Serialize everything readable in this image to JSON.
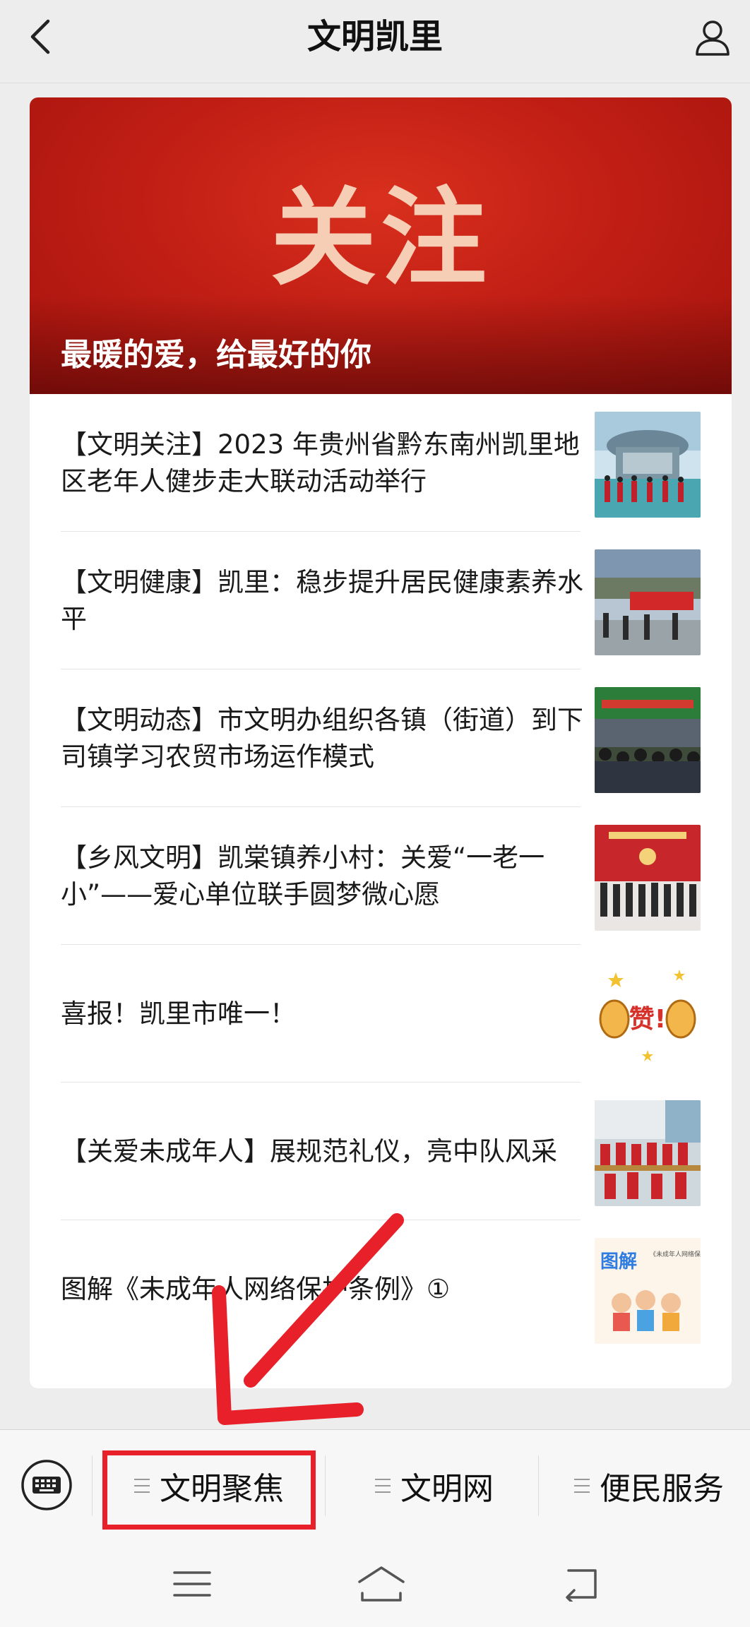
{
  "header": {
    "title": "文明凯里",
    "back_icon": "chevron-left-icon",
    "profile_icon": "user-icon"
  },
  "banner": {
    "big_text": "关注",
    "caption": "最暖的爱，给最好的你",
    "color": "#c21f15"
  },
  "articles": [
    {
      "title": "【文明关注】2023 年贵州省黔东南州凯里地区老年人健步走大联动活动举行"
    },
    {
      "title": "【文明健康】凯里：稳步提升居民健康素养水平"
    },
    {
      "title": "【文明动态】市文明办组织各镇（街道）到下司镇学习农贸市场运作模式"
    },
    {
      "title": "【乡风文明】凯棠镇养小村：关爱“一老一小”——爱心单位联手圆梦微心愿"
    },
    {
      "title": "喜报！凯里市唯一！"
    },
    {
      "title": "【关爱未成年人】展规范礼仪，亮中队风采"
    },
    {
      "title": "图解《未成年人网络保护条例》①"
    }
  ],
  "thumbs": {
    "thumb_5_label": "赞!",
    "thumb_7_title": "图解",
    "thumb_7_sub": "《未成年人网络保护条例》"
  },
  "menu": {
    "keyboard_icon": "keyboard-icon",
    "items": [
      {
        "label": "文明聚焦"
      },
      {
        "label": "文明网"
      },
      {
        "label": "便民服务"
      }
    ],
    "highlight_color": "#e8202a"
  },
  "system_nav": {
    "menu_icon": "menu-icon",
    "home_icon": "home-icon",
    "back_icon": "back-icon"
  }
}
